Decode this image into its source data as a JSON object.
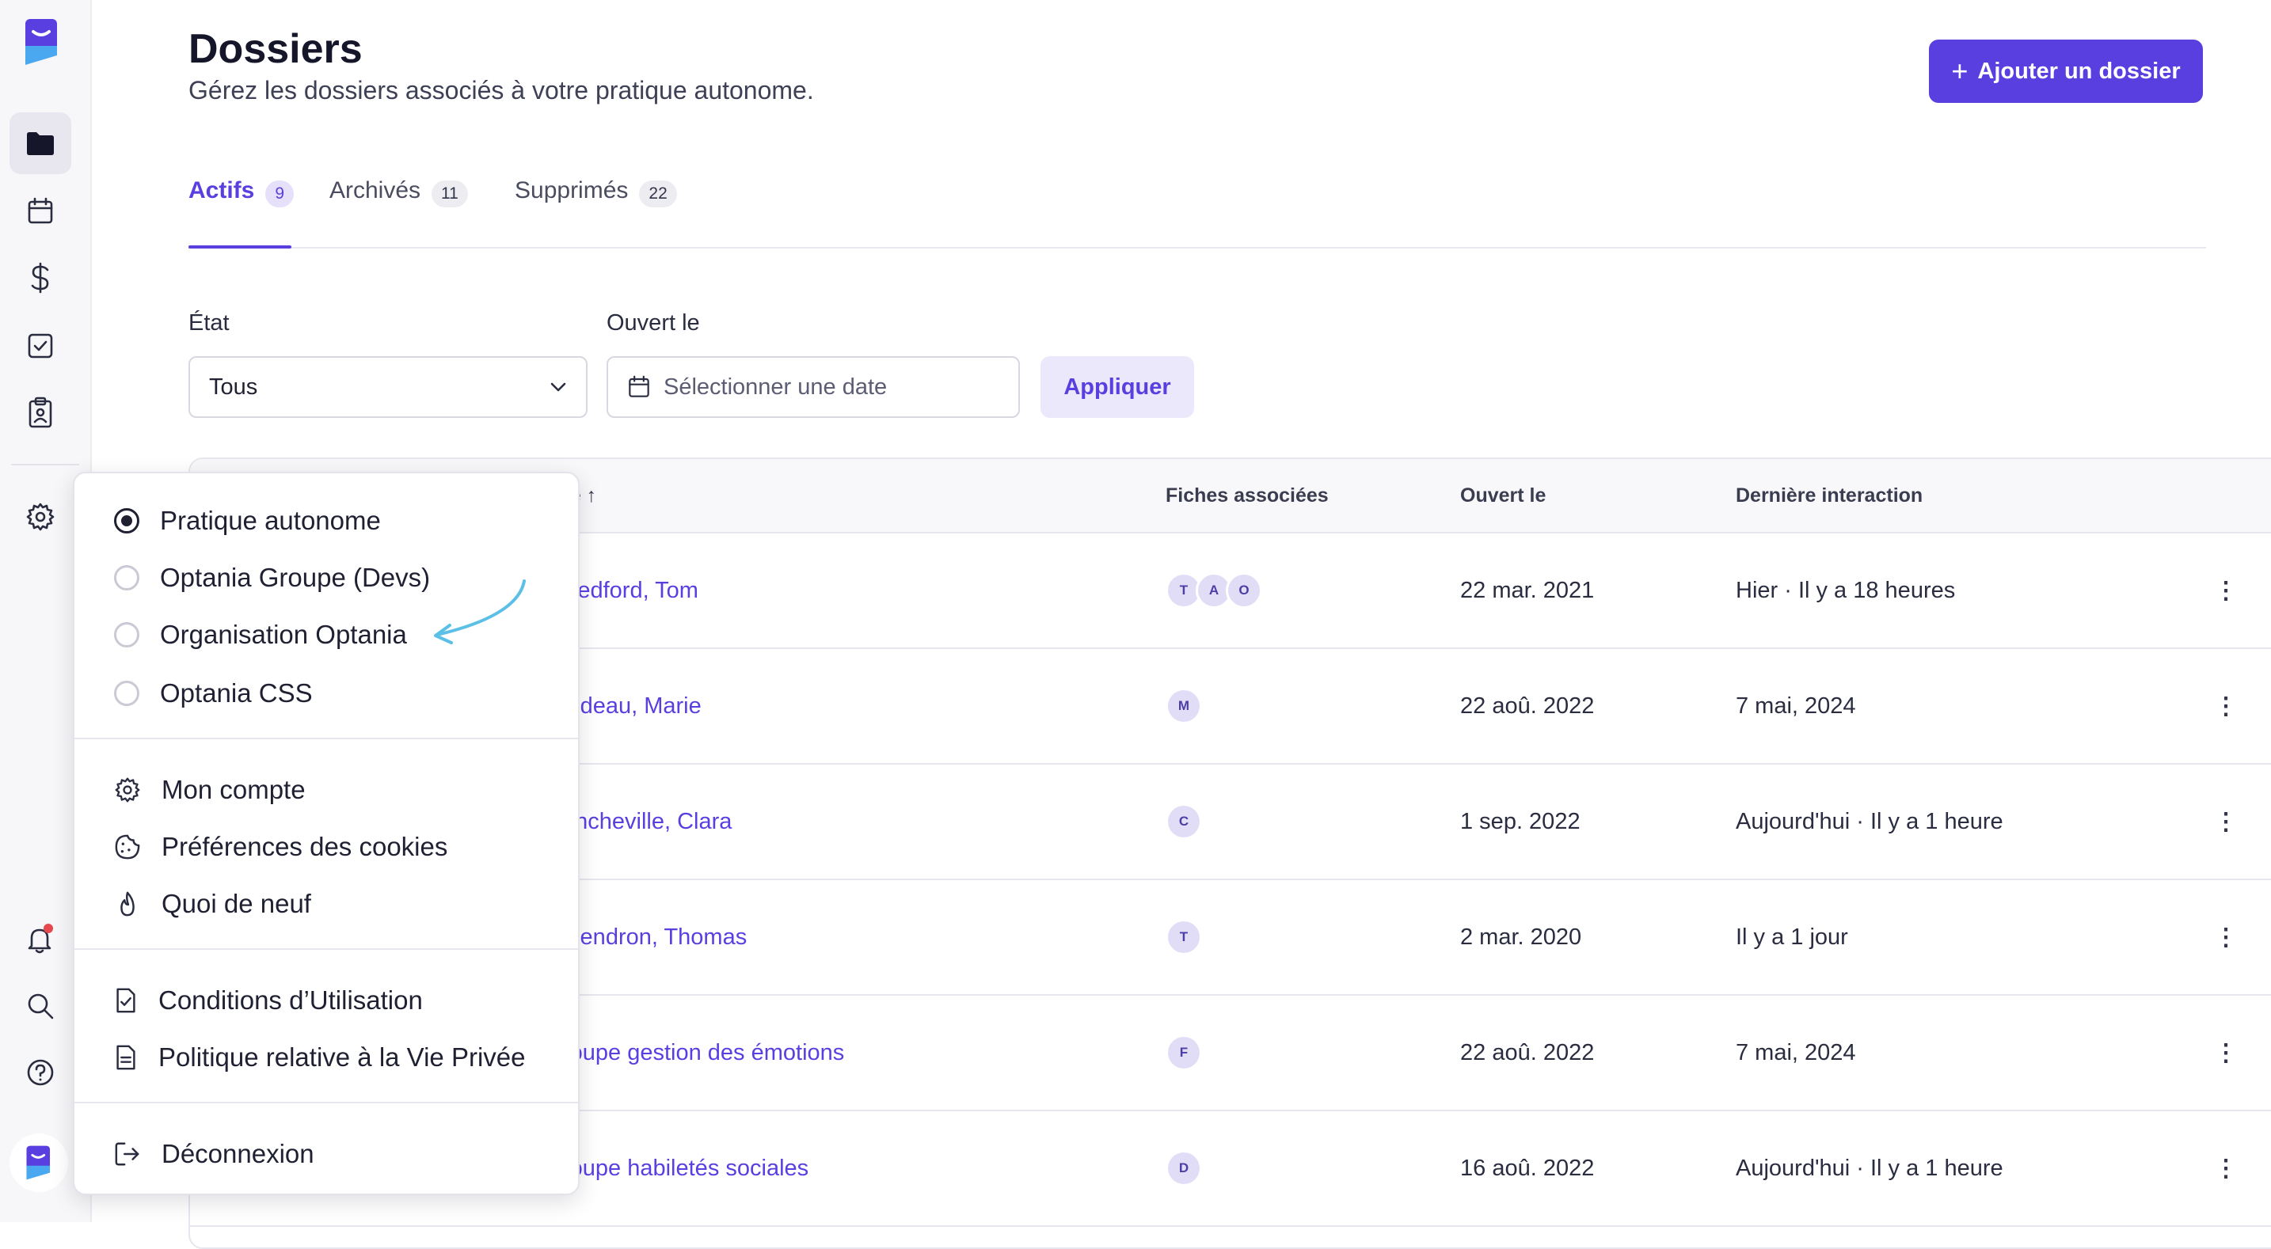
{
  "page": {
    "title": "Dossiers",
    "subtitle": "Gérez les dossiers associés à votre pratique autonome.",
    "add_button": "Ajouter un dossier"
  },
  "tabs": [
    {
      "label": "Actifs",
      "count": "9",
      "active": true
    },
    {
      "label": "Archivés",
      "count": "11",
      "active": false
    },
    {
      "label": "Supprimés",
      "count": "22",
      "active": false
    }
  ],
  "filters": {
    "state_label": "État",
    "state_value": "Tous",
    "opened_label": "Ouvert le",
    "opened_placeholder": "Sélectionner une date",
    "apply_label": "Appliquer"
  },
  "table": {
    "headers": {
      "title": "re ↑",
      "files": "Fiches associées",
      "opened": "Ouvert le",
      "last": "Dernière interaction"
    },
    "rows": [
      {
        "name": "Bedford, Tom",
        "avatars": [
          "T",
          "A",
          "O"
        ],
        "opened": "22 mar. 2021",
        "last": "Hier · Il y a 18 heures"
      },
      {
        "name": "lodeau, Marie",
        "avatars": [
          "M"
        ],
        "opened": "22 aoû. 2022",
        "last": "7 mai, 2024"
      },
      {
        "name": "ancheville, Clara",
        "avatars": [
          "C"
        ],
        "opened": "1 sep. 2022",
        "last": "Aujourd'hui · Il y a 1 heure"
      },
      {
        "name": "Gendron, Thomas",
        "avatars": [
          "T"
        ],
        "opened": "2 mar. 2020",
        "last": "Il y a 1 jour"
      },
      {
        "name": "roupe gestion des émotions",
        "avatars": [
          "F"
        ],
        "opened": "22 aoû. 2022",
        "last": "7 mai, 2024"
      },
      {
        "name": "roupe habiletés sociales",
        "avatars": [
          "D"
        ],
        "opened": "16 aoû. 2022",
        "last": "Aujourd'hui · Il y a 1 heure"
      }
    ]
  },
  "menu": {
    "organizations": [
      {
        "label": "Pratique autonome",
        "selected": true
      },
      {
        "label": "Optania Groupe (Devs)",
        "selected": false
      },
      {
        "label": "Organisation Optania",
        "selected": false
      },
      {
        "label": "Optania CSS",
        "selected": false
      }
    ],
    "account": {
      "my_account": "Mon compte",
      "cookies": "Préférences des cookies",
      "whats_new": "Quoi de neuf"
    },
    "legal": {
      "terms": "Conditions d’Utilisation",
      "privacy": "Politique relative à la Vie Privée"
    },
    "logout": "Déconnexion"
  },
  "colors": {
    "brand": "#5a3fe0",
    "notification_dot": "#e5484d",
    "annotation_arrow": "#5bbfe6"
  }
}
